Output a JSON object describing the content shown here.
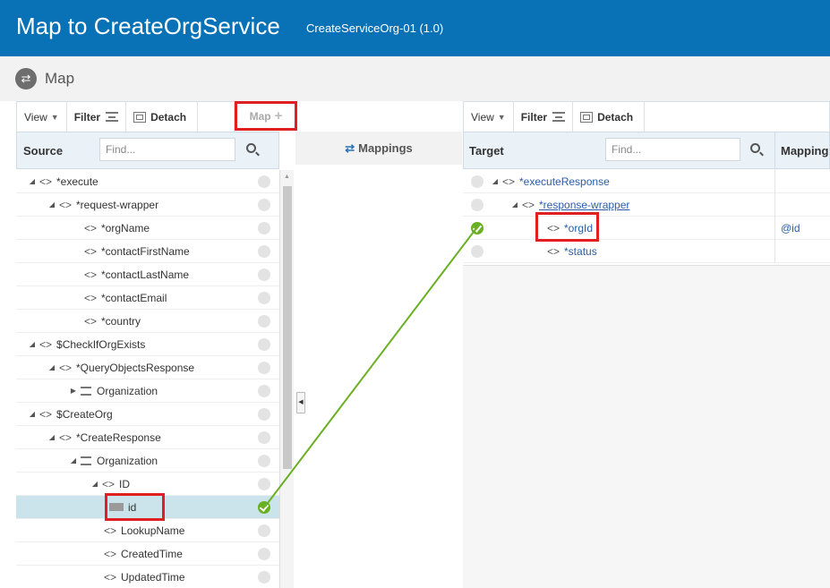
{
  "header": {
    "title": "Map to CreateOrgService",
    "subtitle": "CreateServiceOrg-01 (1.0)"
  },
  "map_section": {
    "title": "Map",
    "icon": "map-arrows-icon"
  },
  "source_toolbar": {
    "view_label": "View",
    "filter_label": "Filter",
    "detach_label": "Detach",
    "map_label": "Map"
  },
  "target_toolbar": {
    "view_label": "View",
    "filter_label": "Filter",
    "detach_label": "Detach"
  },
  "mappings_label": "Mappings",
  "source_panel": {
    "header_label": "Source",
    "find_placeholder": "Find...",
    "rows": [
      {
        "label": "*execute"
      },
      {
        "label": "*request-wrapper"
      },
      {
        "label": "*orgName"
      },
      {
        "label": "*contactFirstName"
      },
      {
        "label": "*contactLastName"
      },
      {
        "label": "*contactEmail"
      },
      {
        "label": "*country"
      },
      {
        "label": "$CheckIfOrgExists"
      },
      {
        "label": "*QueryObjectsResponse"
      },
      {
        "label": "Organization"
      },
      {
        "label": "$CreateOrg"
      },
      {
        "label": "*CreateResponse"
      },
      {
        "label": "Organization"
      },
      {
        "label": "ID"
      },
      {
        "label": "id",
        "mapped": true,
        "selected": true
      },
      {
        "label": "LookupName"
      },
      {
        "label": "CreatedTime"
      },
      {
        "label": "UpdatedTime"
      }
    ]
  },
  "target_panel": {
    "header_label": "Target",
    "find_placeholder": "Find...",
    "mapping_col_label": "Mapping",
    "rows": [
      {
        "label": "*executeResponse",
        "mapping": ""
      },
      {
        "label": "*response-wrapper",
        "mapping": ""
      },
      {
        "label": "*orgId",
        "mapping": "@id",
        "mapped": true
      },
      {
        "label": "*status",
        "mapping": ""
      }
    ]
  },
  "colors": {
    "header_bg": "#0972b6",
    "highlight_red": "#e02020",
    "mapping_line_green": "#6ab023",
    "selected_row": "#cbe3ea"
  }
}
